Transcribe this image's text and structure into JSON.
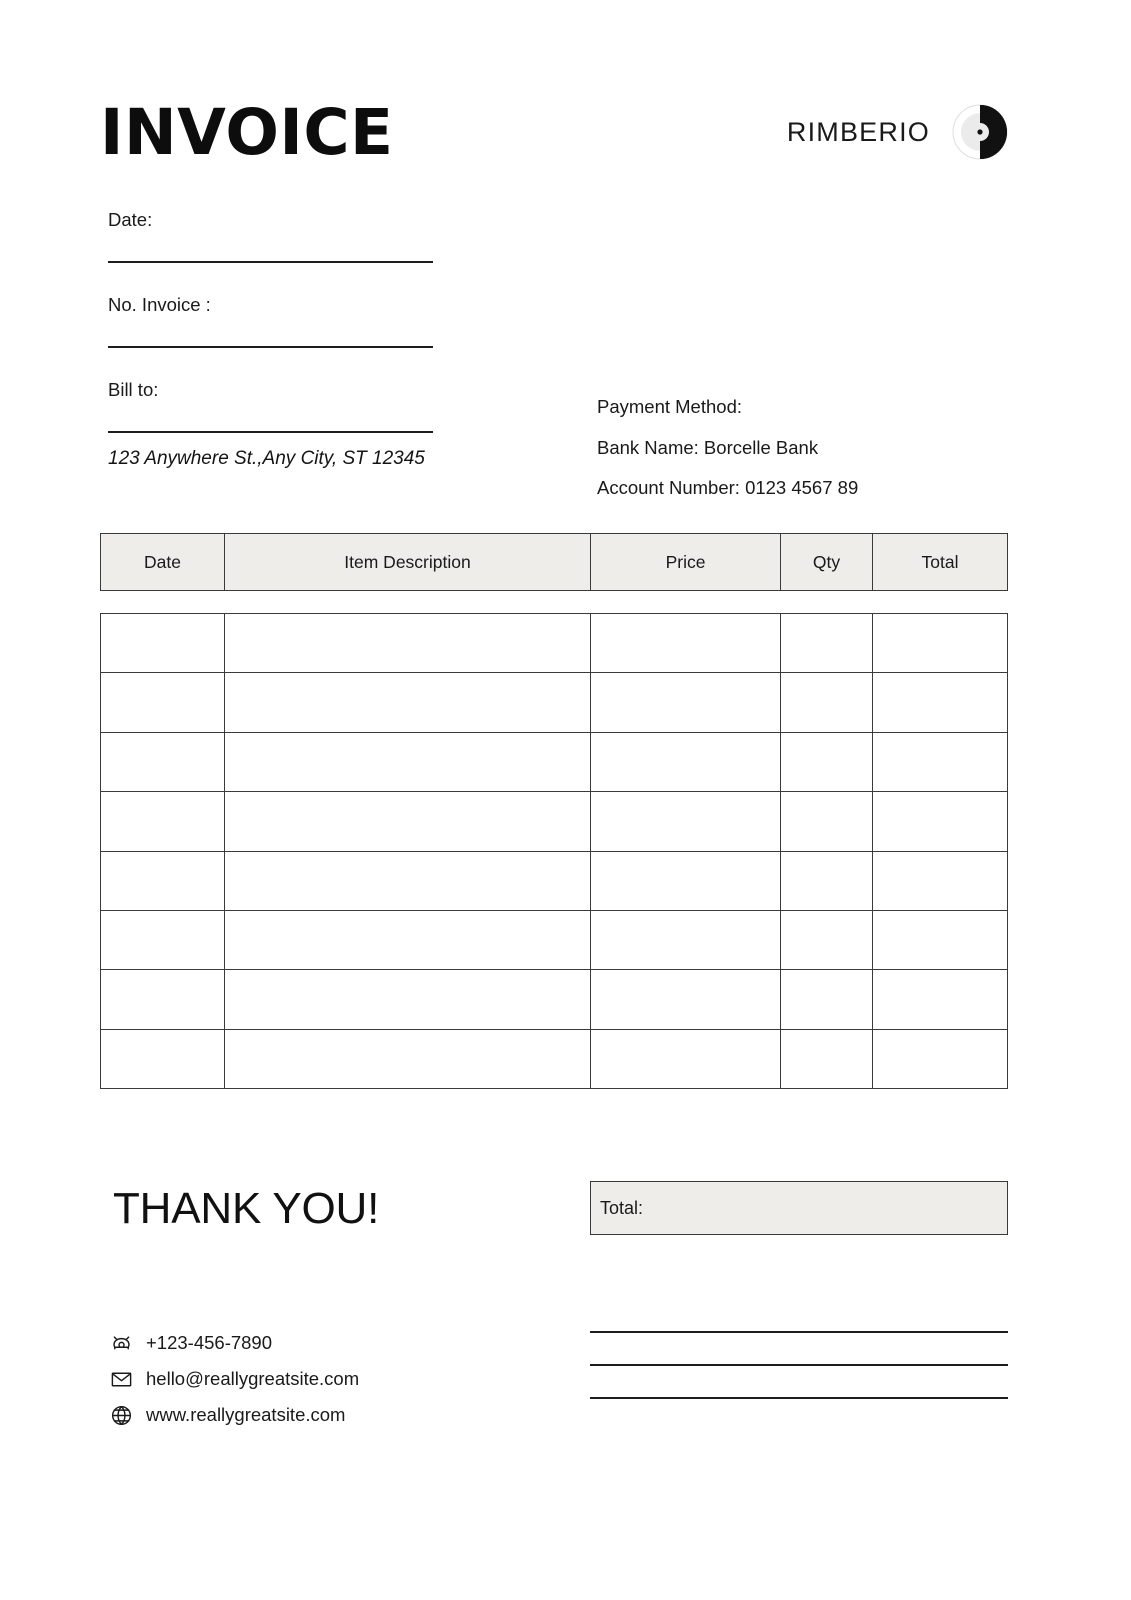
{
  "document": {
    "title": "INVOICE"
  },
  "brand": {
    "name": "RIMBERIO",
    "logo_icon": "rimberio-circle-logo",
    "logo_dark": "#111111",
    "logo_light": "#e8e8e8"
  },
  "meta": {
    "date_label": "Date:",
    "invoice_no_label": "No. Invoice :",
    "bill_to_label": "Bill to:",
    "bill_to_address": "123 Anywhere St.,Any City, ST 12345"
  },
  "payment": {
    "heading": "Payment Method:",
    "bank_name": "Bank Name: Borcelle Bank",
    "account_number": "Account Number: 0123 4567 89"
  },
  "table": {
    "columns": [
      "Date",
      "Item Description",
      "Price",
      "Qty",
      "Total"
    ],
    "rows": [
      [
        "",
        "",
        "",
        "",
        ""
      ],
      [
        "",
        "",
        "",
        "",
        ""
      ],
      [
        "",
        "",
        "",
        "",
        ""
      ],
      [
        "",
        "",
        "",
        "",
        ""
      ],
      [
        "",
        "",
        "",
        "",
        ""
      ],
      [
        "",
        "",
        "",
        "",
        ""
      ],
      [
        "",
        "",
        "",
        "",
        ""
      ],
      [
        "",
        "",
        "",
        "",
        ""
      ]
    ],
    "header_bg": "#efedea",
    "border_color": "#3a3a3a"
  },
  "footer": {
    "thank_you": "THANK YOU!",
    "total_label": "Total:",
    "total_bg": "#efedea",
    "contacts": [
      {
        "icon": "phone-icon",
        "text": "+123-456-7890"
      },
      {
        "icon": "email-icon",
        "text": "hello@reallygreatsite.com"
      },
      {
        "icon": "globe-icon",
        "text": "www.reallygreatsite.com"
      }
    ],
    "signature_rule_count": 3
  }
}
